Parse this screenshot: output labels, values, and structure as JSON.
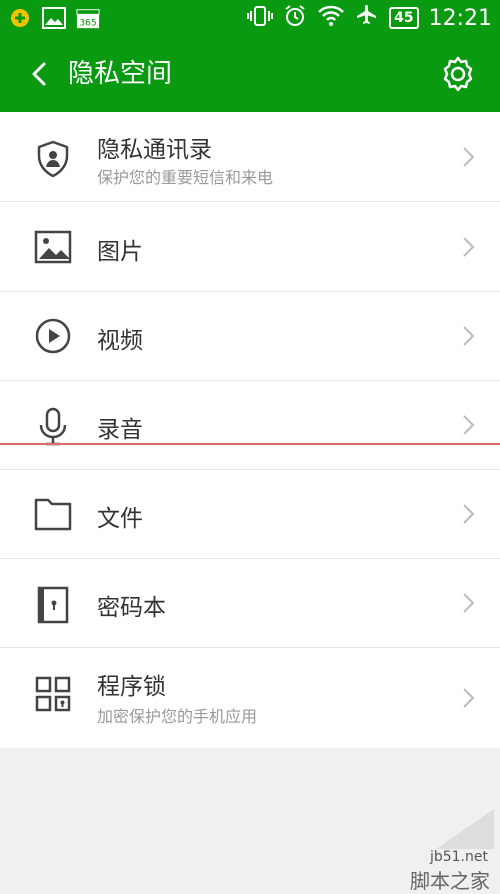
{
  "statusbar": {
    "left_icons": [
      "app-notification-icon",
      "gallery-icon",
      "calendar-365-icon"
    ],
    "calendar_text": "365",
    "battery": "45",
    "time": "12:21"
  },
  "appbar": {
    "title": "隐私空间"
  },
  "items": [
    {
      "label": "隐私通讯录",
      "sub": "保护您的重要短信和来电",
      "icon": "shield-contact-icon"
    },
    {
      "label": "图片",
      "sub": "",
      "icon": "image-icon"
    },
    {
      "label": "视频",
      "sub": "",
      "icon": "play-icon"
    },
    {
      "label": "录音",
      "sub": "",
      "icon": "microphone-icon"
    },
    {
      "label": "文件",
      "sub": "",
      "icon": "folder-icon"
    },
    {
      "label": "密码本",
      "sub": "",
      "icon": "notebook-lock-icon"
    },
    {
      "label": "程序锁",
      "sub": "加密保护您的手机应用",
      "icon": "app-lock-icon"
    }
  ],
  "watermark": {
    "site": "jb51.net",
    "name": "脚本之家"
  },
  "colors": {
    "brand": "#0a9a12",
    "text": "#333333",
    "subtext": "#9a9a9a"
  }
}
